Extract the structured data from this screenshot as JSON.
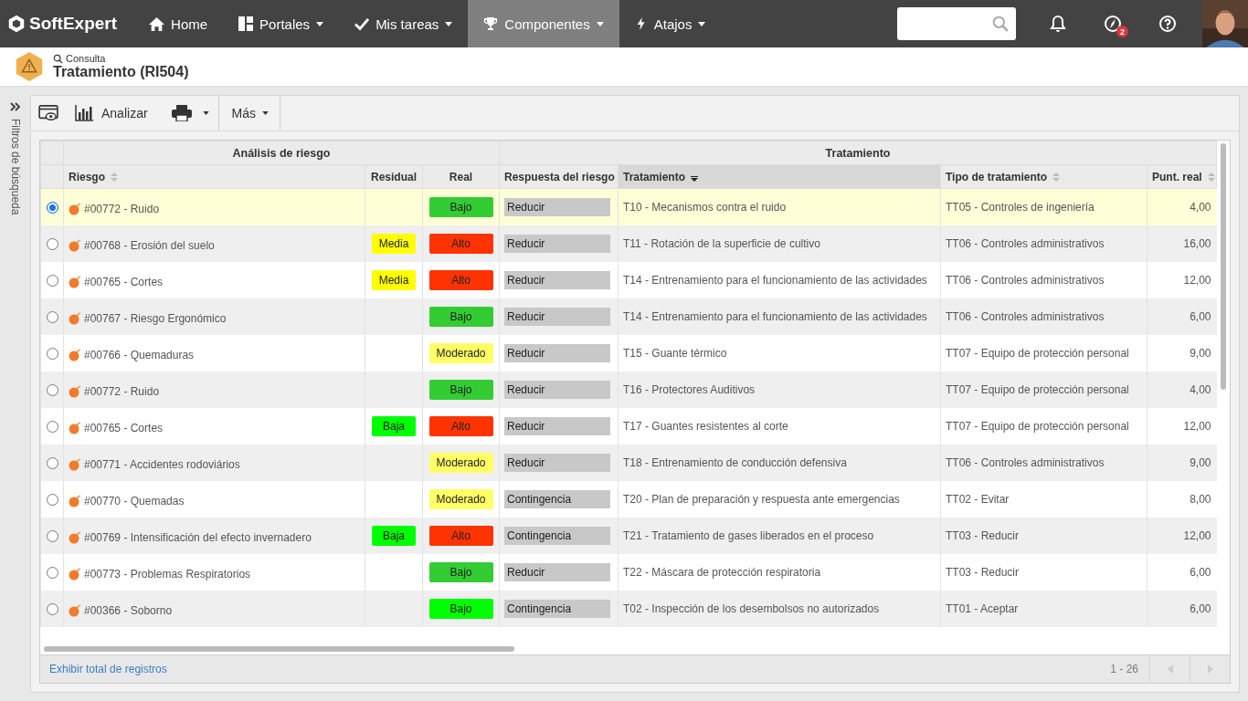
{
  "nav": {
    "brand": "SoftExpert",
    "items": [
      {
        "label": "Home",
        "selected": false
      },
      {
        "label": "Portales",
        "selected": false
      },
      {
        "label": "Mis tareas",
        "selected": false
      },
      {
        "label": "Componentes",
        "selected": true
      },
      {
        "label": "Atajos",
        "selected": false
      }
    ],
    "notification_badge": "2"
  },
  "header": {
    "breadcrumb": "Consulta",
    "title": "Tratamiento (RI504)"
  },
  "sidebar": {
    "label": "Filtros de búsqueda"
  },
  "toolbar": {
    "analyze": "Analizar",
    "more": "Más"
  },
  "table": {
    "groups": [
      "Análisis de riesgo",
      "Tratamiento"
    ],
    "columns": [
      "Riesgo",
      "Residual",
      "Real",
      "Respuesta del riesgo",
      "Tratamiento",
      "Tipo de tratamiento",
      "Punt. real"
    ],
    "rows": [
      {
        "selected": true,
        "riesgo": "#00772 - Ruido",
        "real": {
          "text": "Bajo",
          "color": "#33cc33"
        },
        "respuesta": "Reducir",
        "tratamiento": "T10 - Mecanismos contra el ruido",
        "tipo": "TT05 - Controles de ingeniería",
        "punt": "4,00"
      },
      {
        "selected": false,
        "riesgo": "#00768 - Erosión del suelo",
        "residual": {
          "text": "Media",
          "color": "#ffff00"
        },
        "real": {
          "text": "Alto",
          "color": "#ff3300"
        },
        "respuesta": "Reducir",
        "tratamiento": "T11 - Rotación de la superficie de cultivo",
        "tipo": "TT06 - Controles administrativos",
        "punt": "16,00"
      },
      {
        "selected": false,
        "riesgo": "#00765 - Cortes",
        "residual": {
          "text": "Media",
          "color": "#ffff00"
        },
        "real": {
          "text": "Alto",
          "color": "#ff3300"
        },
        "respuesta": "Reducir",
        "tratamiento": "T14 - Entrenamiento para el funcionamiento de las actividades",
        "tipo": "TT06 - Controles administrativos",
        "punt": "12,00"
      },
      {
        "selected": false,
        "riesgo": "#00767 - Riesgo Ergonómico",
        "real": {
          "text": "Bajo",
          "color": "#33cc33"
        },
        "respuesta": "Reducir",
        "tratamiento": "T14 - Entrenamiento para el funcionamiento de las actividades",
        "tipo": "TT06 - Controles administrativos",
        "punt": "6,00"
      },
      {
        "selected": false,
        "riesgo": "#00766 - Quemaduras",
        "real": {
          "text": "Moderado",
          "color": "#ffff66"
        },
        "respuesta": "Reducir",
        "tratamiento": "T15 - Guante térmico",
        "tipo": "TT07 - Equipo de protección personal",
        "punt": "9,00"
      },
      {
        "selected": false,
        "riesgo": "#00772 - Ruido",
        "real": {
          "text": "Bajo",
          "color": "#33cc33"
        },
        "respuesta": "Reducir",
        "tratamiento": "T16 - Protectores Auditivos",
        "tipo": "TT07 - Equipo de protección personal",
        "punt": "4,00"
      },
      {
        "selected": false,
        "riesgo": "#00765 - Cortes",
        "residual": {
          "text": "Baja",
          "color": "#00ff00"
        },
        "real": {
          "text": "Alto",
          "color": "#ff3300"
        },
        "respuesta": "Reducir",
        "tratamiento": "T17 - Guantes resistentes al corte",
        "tipo": "TT07 - Equipo de protección personal",
        "punt": "12,00"
      },
      {
        "selected": false,
        "riesgo": "#00771 - Accidentes rodoviários",
        "real": {
          "text": "Moderado",
          "color": "#ffff66"
        },
        "respuesta": "Reducir",
        "tratamiento": "T18 - Entrenamiento de conducción defensiva",
        "tipo": "TT06 - Controles administrativos",
        "punt": "9,00"
      },
      {
        "selected": false,
        "riesgo": "#00770 - Quemadas",
        "real": {
          "text": "Moderado",
          "color": "#ffff66"
        },
        "respuesta": "Contingencia",
        "tratamiento": "T20 - Plan de preparación y respuesta ante emergencias",
        "tipo": "TT02 - Evitar",
        "punt": "8,00"
      },
      {
        "selected": false,
        "riesgo": "#00769 - Intensificación del efecto invernadero",
        "residual": {
          "text": "Baja",
          "color": "#00ff00"
        },
        "real": {
          "text": "Alto",
          "color": "#ff3300"
        },
        "respuesta": "Contingencia",
        "tratamiento": "T21 - Tratamiento de gases liberados en el proceso",
        "tipo": "TT03 - Reducir",
        "punt": "12,00"
      },
      {
        "selected": false,
        "riesgo": "#00773 - Problemas Respiratorios",
        "real": {
          "text": "Bajo",
          "color": "#33cc33"
        },
        "respuesta": "Reducir",
        "tratamiento": "T22 - Máscara de protección respiratoria",
        "tipo": "TT03 - Reducir",
        "punt": "6,00"
      },
      {
        "selected": false,
        "riesgo": "#00366 - Soborno",
        "real": {
          "text": "Bajo",
          "color": "#00ff00"
        },
        "respuesta": "Contingencia",
        "tratamiento": "T02 - Inspección de los desembolsos no autorizados",
        "tipo": "TT01 - Aceptar",
        "punt": "6,00"
      }
    ]
  },
  "footer": {
    "link": "Exhibir total de registros",
    "range": "1 - 26"
  }
}
